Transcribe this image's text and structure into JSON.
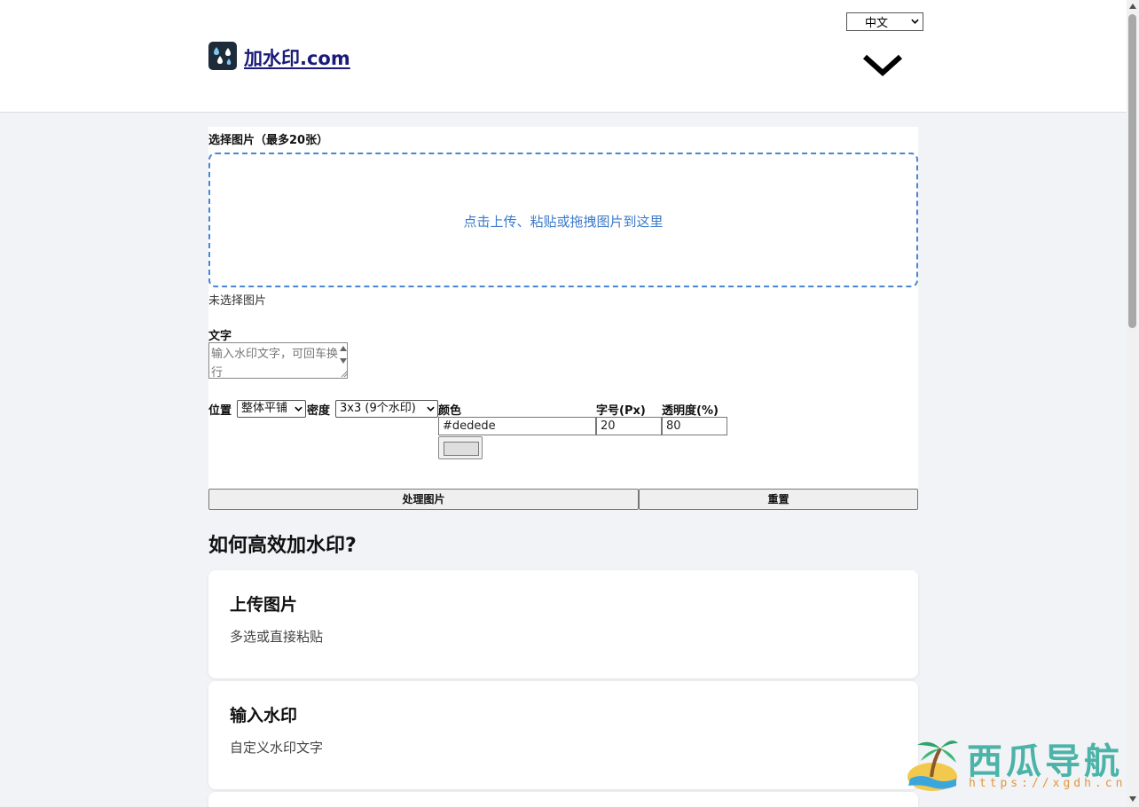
{
  "header": {
    "language": "中文",
    "site_name": "加水印.com"
  },
  "upload": {
    "label": "选择图片（最多20张）",
    "dropzone_text": "点击上传、粘贴或拖拽图片到这里",
    "status": "未选择图片"
  },
  "text_field": {
    "label": "文字",
    "placeholder": "输入水印文字，可回车换行"
  },
  "options": {
    "position_label": "位置",
    "position_value": "整体平铺",
    "density_label": "密度",
    "density_value": "3x3 (9个水印)",
    "color_label": "颜色",
    "color_value": "#dedede",
    "font_size_label": "字号(Px)",
    "font_size_value": "20",
    "opacity_label": "透明度(%)",
    "opacity_value": "80"
  },
  "actions": {
    "process": "处理图片",
    "reset": "重置"
  },
  "howto": {
    "title": "如何高效加水印?",
    "cards": [
      {
        "title": "上传图片",
        "desc": "多选或直接粘贴"
      },
      {
        "title": "输入水印",
        "desc": "自定义水印文字"
      }
    ]
  },
  "watermark_overlay": {
    "name": "西瓜导航",
    "url": "https://xgdh.cn"
  },
  "colors": {
    "accent_blue": "#3b7ac9",
    "page_bg": "#f1f3f6",
    "swatch": "#dedede"
  },
  "icons": [
    "raindrops-logo-icon",
    "chevron-down-icon",
    "select-arrow-icon",
    "palm-island-logo"
  ]
}
